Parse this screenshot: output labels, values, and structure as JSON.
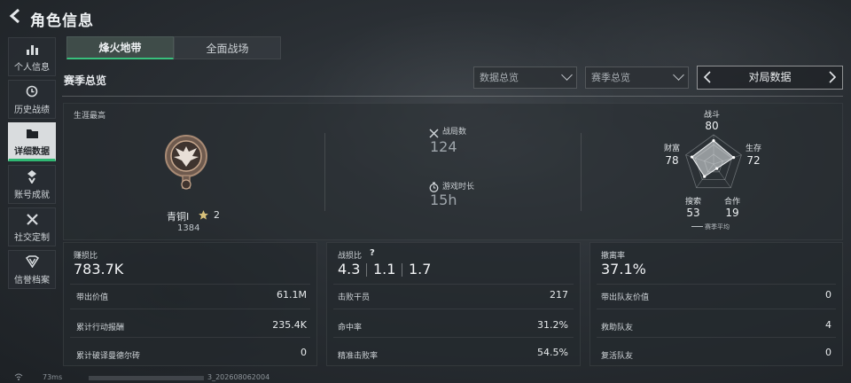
{
  "header": {
    "title": "角色信息"
  },
  "sidebar": {
    "items": [
      {
        "label": "个人信息",
        "icon": "bar-chart-icon"
      },
      {
        "label": "历史战绩",
        "icon": "clock-icon"
      },
      {
        "label": "详细数据",
        "icon": "folder-icon",
        "active": true
      },
      {
        "label": "账号成就",
        "icon": "medal-icon"
      },
      {
        "label": "社交定制",
        "icon": "tools-icon"
      },
      {
        "label": "信誉档案",
        "icon": "shield-icon"
      }
    ]
  },
  "tabs": [
    {
      "label": "烽火地带",
      "active": true
    },
    {
      "label": "全面战场",
      "active": false
    }
  ],
  "section_title": "赛季总览",
  "filters": {
    "data_overview": "数据总览",
    "season_overview": "赛季总览",
    "match_data": "对局数据"
  },
  "overview": {
    "career_label": "生涯最高",
    "rank": {
      "name": "青铜I",
      "stars": "2",
      "points": "1384"
    },
    "matches": {
      "label": "战局数",
      "value": "124"
    },
    "play_time": {
      "label": "游戏时长",
      "value": "15h"
    }
  },
  "radar": {
    "axes": [
      {
        "label": "战斗",
        "value": "80"
      },
      {
        "label": "生存",
        "value": "72"
      },
      {
        "label": "合作",
        "value": "19"
      },
      {
        "label": "搜索",
        "value": "53"
      },
      {
        "label": "财富",
        "value": "78"
      }
    ],
    "legend": "赛季平均"
  },
  "cards": [
    {
      "title": "赚损比",
      "value": "783.7K",
      "rows": [
        {
          "label": "带出价值",
          "value": "61.1M"
        },
        {
          "label": "累计行动报酬",
          "value": "235.4K"
        },
        {
          "label": "累计破译曼德尔砖",
          "value": "0"
        }
      ]
    },
    {
      "title": "战损比",
      "values": [
        "4.3",
        "1.1",
        "1.7"
      ],
      "help": "?",
      "rows": [
        {
          "label": "击败干员",
          "value": "217"
        },
        {
          "label": "命中率",
          "value": "31.2%"
        },
        {
          "label": "精准击败率",
          "value": "54.5%"
        }
      ]
    },
    {
      "title": "撤离率",
      "value": "37.1%",
      "rows": [
        {
          "label": "带出队友价值",
          "value": "0"
        },
        {
          "label": "救助队友",
          "value": "4"
        },
        {
          "label": "复活队友",
          "value": "0"
        }
      ]
    }
  ],
  "footer": {
    "ping": "73ms",
    "uid": "3_20260806200​4"
  },
  "colors": {
    "accent": "#38c07c",
    "background": "#2a2f34"
  }
}
